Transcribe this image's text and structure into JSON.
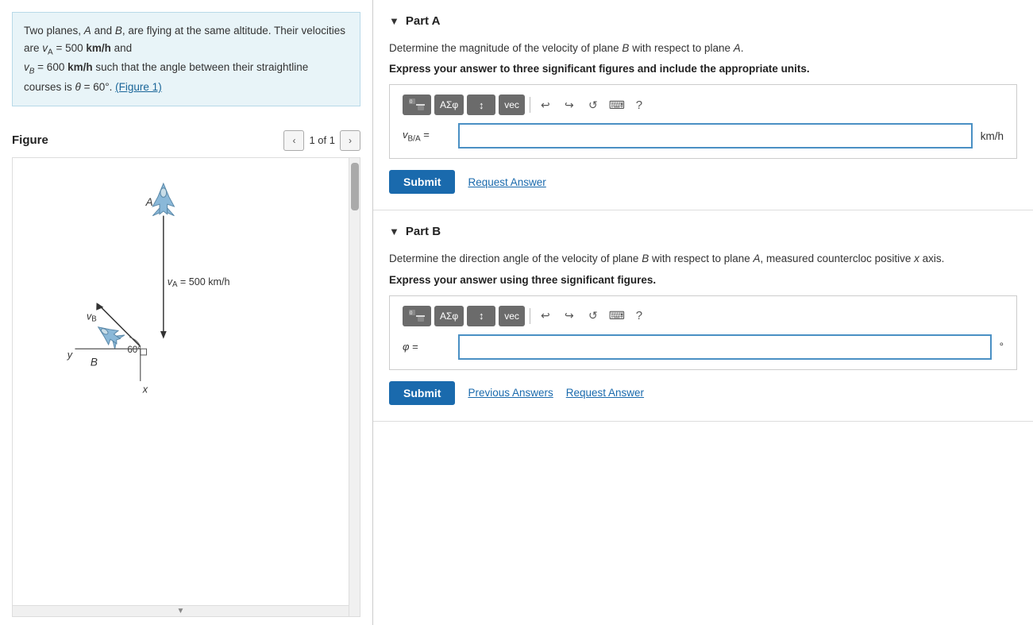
{
  "left": {
    "problem": {
      "text1": "Two planes, ",
      "A": "A",
      "text2": " and ",
      "B": "B",
      "text3": ", are flying at the same altitude. Their velocities are ",
      "vA": "v",
      "vA_sub": "A",
      "text4": " = 500 ",
      "unit1": "km/h",
      "text5": " and",
      "vB": "v",
      "vB_sub": "B",
      "text6": " = 600  ",
      "unit2": "km/h",
      "text7": " such that the angle between their straightline courses is ",
      "theta": "θ",
      "text8": " = 60°.",
      "figureLink": "(Figure 1)"
    },
    "figure": {
      "label": "Figure",
      "page": "1 of 1"
    }
  },
  "right": {
    "partA": {
      "title": "Part A",
      "description1": "Determine the magnitude of the velocity of plane ",
      "B": "B",
      "description2": " with respect to plane ",
      "A": "A",
      "description3": ".",
      "instruction": "Express your answer to three significant figures and include the appropriate units.",
      "inputLabel": "v",
      "inputSub": "B/A",
      "inputEquals": "=",
      "unit": "km/h",
      "submitLabel": "Submit",
      "requestAnswerLabel": "Request Answer",
      "toolbar": {
        "fraction": "⁰√□",
        "aeq": "ΑΣφ",
        "arrows": "↕",
        "vec": "vec",
        "undo": "↩",
        "redo": "↪",
        "refresh": "↺",
        "keyboard": "⌨",
        "help": "?"
      }
    },
    "partB": {
      "title": "Part B",
      "description1": "Determine the direction angle of the velocity of plane ",
      "B": "B",
      "description2": " with respect to plane ",
      "A": "A",
      "description3": ", measured countercloc positive ",
      "x": "x",
      "description4": " axis.",
      "instruction": "Express your answer using three significant figures.",
      "inputLabel": "φ",
      "inputEquals": "=",
      "unit": "°",
      "submitLabel": "Submit",
      "previousAnswersLabel": "Previous Answers",
      "requestAnswerLabel": "Request Answer",
      "toolbar": {
        "fraction": "⁰√□",
        "aeq": "ΑΣφ",
        "arrows": "↕",
        "vec": "vec",
        "undo": "↩",
        "redo": "↪",
        "refresh": "↺",
        "keyboard": "⌨",
        "help": "?"
      }
    }
  }
}
